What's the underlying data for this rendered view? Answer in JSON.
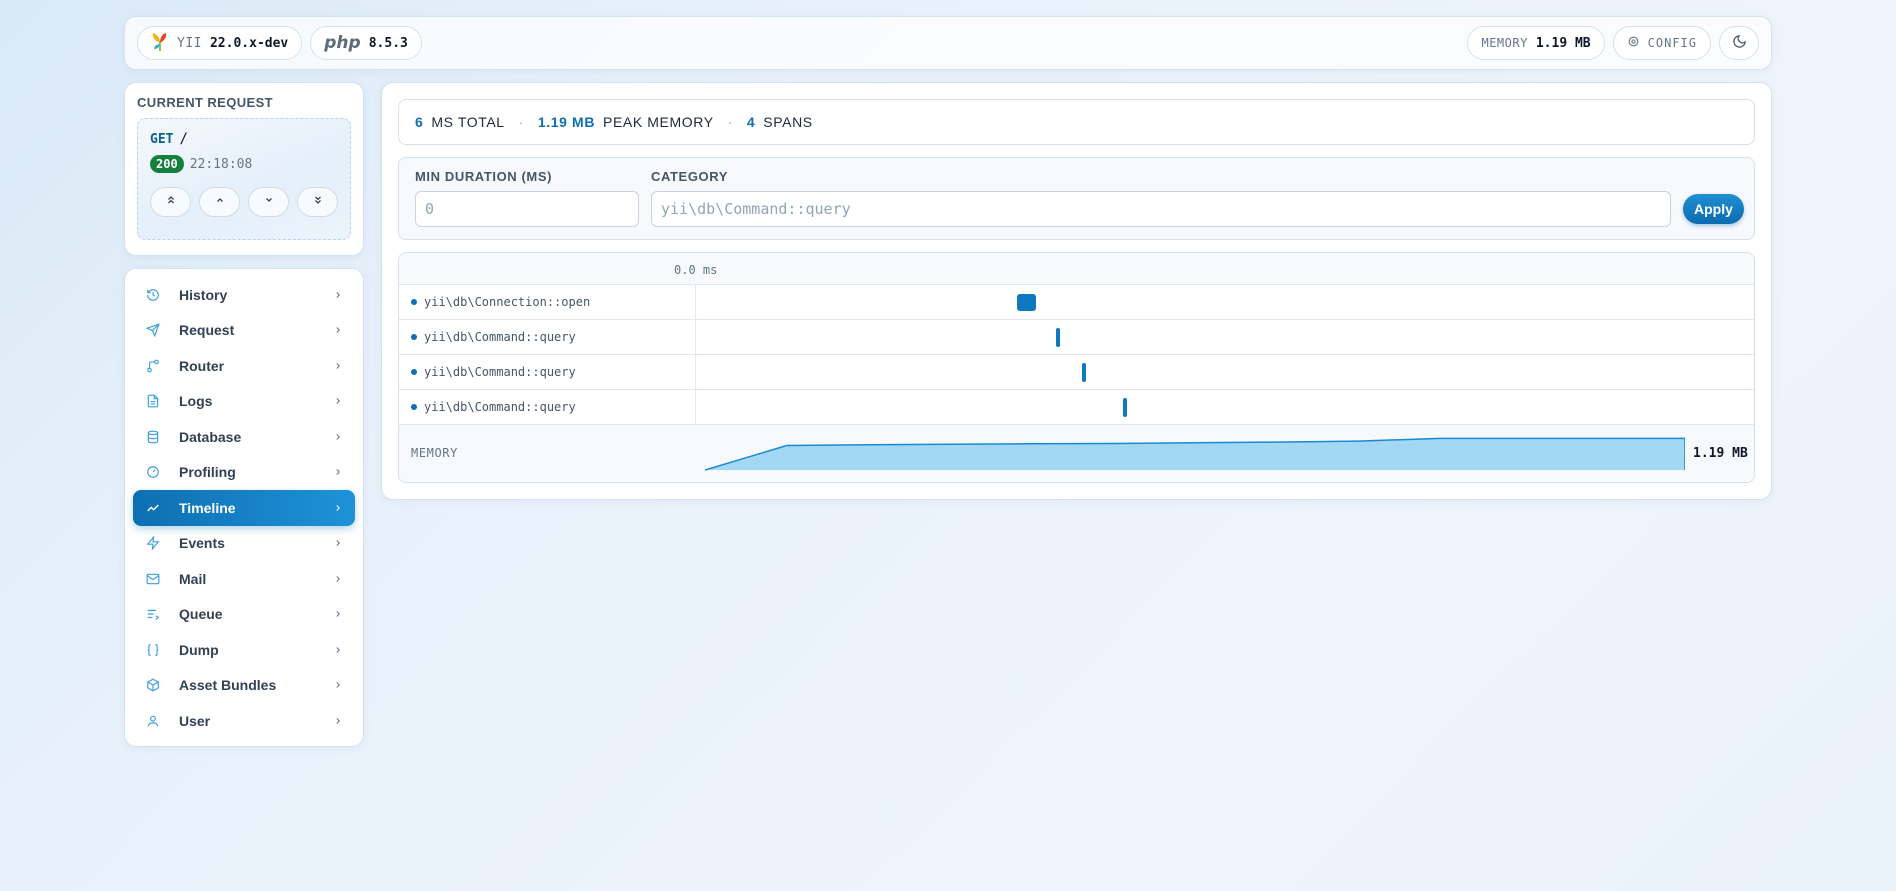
{
  "topbar": {
    "yii_label": "YII",
    "yii_version": "22.0.x-dev",
    "php_label": "php",
    "php_version": "8.5.3",
    "memory_label": "MEMORY",
    "memory_value": "1.19 MB",
    "config_label": "CONFIG",
    "theme_icon": "moon-icon"
  },
  "request": {
    "heading": "CURRENT REQUEST",
    "method": "GET",
    "path": "/",
    "status": "200",
    "time": "22:18:08",
    "nav_icons": [
      "chevrons-up-icon",
      "chevron-up-icon",
      "chevron-down-icon",
      "chevrons-down-icon"
    ]
  },
  "sidebar": {
    "items": [
      {
        "label": "History",
        "icon": "history-icon"
      },
      {
        "label": "Request",
        "icon": "send-icon"
      },
      {
        "label": "Router",
        "icon": "route-icon"
      },
      {
        "label": "Logs",
        "icon": "file-text-icon"
      },
      {
        "label": "Database",
        "icon": "database-icon"
      },
      {
        "label": "Profiling",
        "icon": "gauge-icon"
      },
      {
        "label": "Timeline",
        "icon": "activity-icon",
        "active": true
      },
      {
        "label": "Events",
        "icon": "zap-icon"
      },
      {
        "label": "Mail",
        "icon": "mail-icon"
      },
      {
        "label": "Queue",
        "icon": "list-icon"
      },
      {
        "label": "Dump",
        "icon": "braces-icon"
      },
      {
        "label": "Asset Bundles",
        "icon": "package-icon"
      },
      {
        "label": "User",
        "icon": "user-icon"
      }
    ]
  },
  "summary": {
    "total_value": "6",
    "total_label": "MS TOTAL",
    "memory_value": "1.19 MB",
    "memory_label": "PEAK MEMORY",
    "spans_value": "4",
    "spans_label": "SPANS",
    "separator": "·"
  },
  "filters": {
    "min_duration_label": "MIN DURATION (MS)",
    "min_duration_placeholder": "0",
    "category_label": "CATEGORY",
    "category_placeholder": "yii\\db\\Command::query",
    "apply_label": "Apply"
  },
  "timeline": {
    "scale_start": "0.0 ms",
    "spans": [
      {
        "name": "yii\\db\\Connection::open",
        "start": 0.303,
        "duration": 0.018
      },
      {
        "name": "yii\\db\\Command::query",
        "start": 0.34,
        "duration": 0.003
      },
      {
        "name": "yii\\db\\Command::query",
        "start": 0.365,
        "duration": 0.003
      },
      {
        "name": "yii\\db\\Command::query",
        "start": 0.404,
        "duration": 0.003
      }
    ],
    "memory_label": "MEMORY",
    "memory_peak": "1.19 MB",
    "memory_curve": [
      0.0,
      0.72,
      0.74,
      0.76,
      0.77,
      0.78,
      0.8,
      0.82,
      0.85,
      0.93,
      0.93,
      0.93,
      0.93
    ]
  }
}
